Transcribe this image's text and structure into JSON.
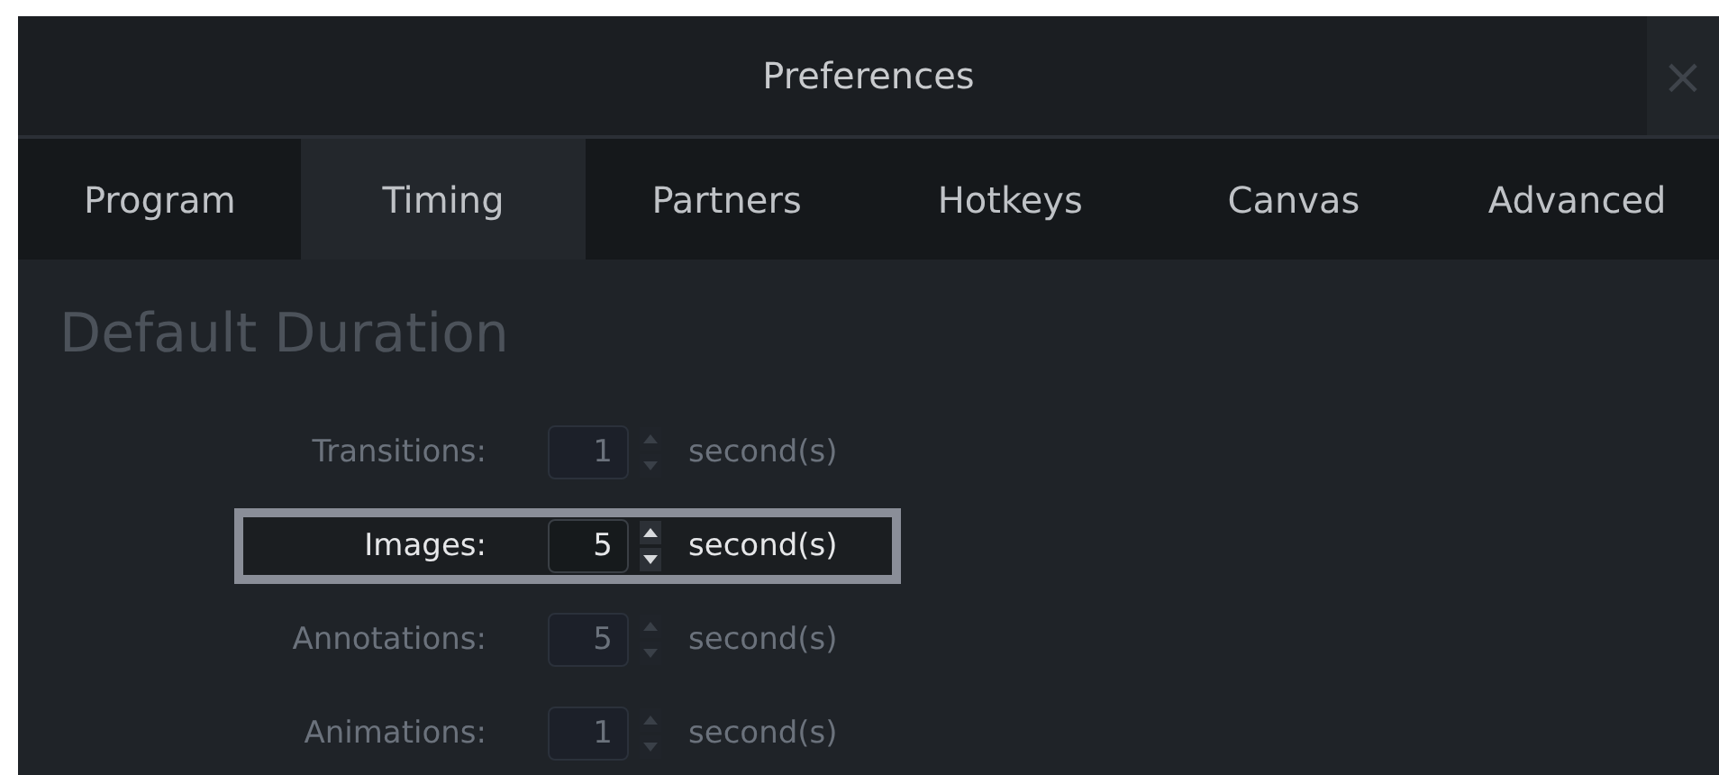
{
  "window": {
    "title": "Preferences",
    "close": "×"
  },
  "tabs": [
    {
      "label": "Program",
      "selected": false
    },
    {
      "label": "Timing",
      "selected": true
    },
    {
      "label": "Partners",
      "selected": false
    },
    {
      "label": "Hotkeys",
      "selected": false
    },
    {
      "label": "Canvas",
      "selected": false
    },
    {
      "label": "Advanced",
      "selected": false
    }
  ],
  "section": {
    "heading": "Default Duration",
    "rows": [
      {
        "label": "Transitions:",
        "value": "1",
        "unit": "second(s)",
        "highlighted": false
      },
      {
        "label": "Images:",
        "value": "5",
        "unit": "second(s)",
        "highlighted": true
      },
      {
        "label": "Annotations:",
        "value": "5",
        "unit": "second(s)",
        "highlighted": false
      },
      {
        "label": "Animations:",
        "value": "1",
        "unit": "second(s)",
        "highlighted": false
      }
    ]
  }
}
